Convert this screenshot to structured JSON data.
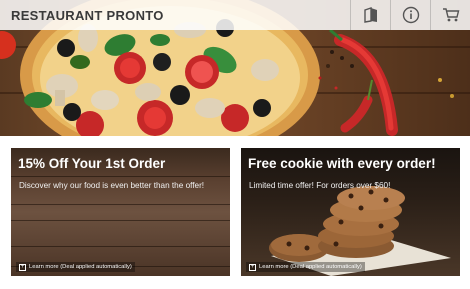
{
  "header": {
    "brand": "RESTAURANT PRONTO",
    "icons": [
      "menu-book-icon",
      "info-icon",
      "cart-icon"
    ]
  },
  "promos": [
    {
      "title": "15% Off Your 1st Order",
      "subtitle": "Discover why our food is even better than the offer!",
      "link": "Learn more (Deal applied automatically)"
    },
    {
      "title": "Free cookie with every order!",
      "subtitle": "Limited time offer! For orders over $60!",
      "link": "Learn more (Deal applied automatically)"
    }
  ],
  "colors": {
    "header_bg": "#ffffff",
    "brand_text": "#3a3a3a",
    "card_text": "#ffffff"
  }
}
